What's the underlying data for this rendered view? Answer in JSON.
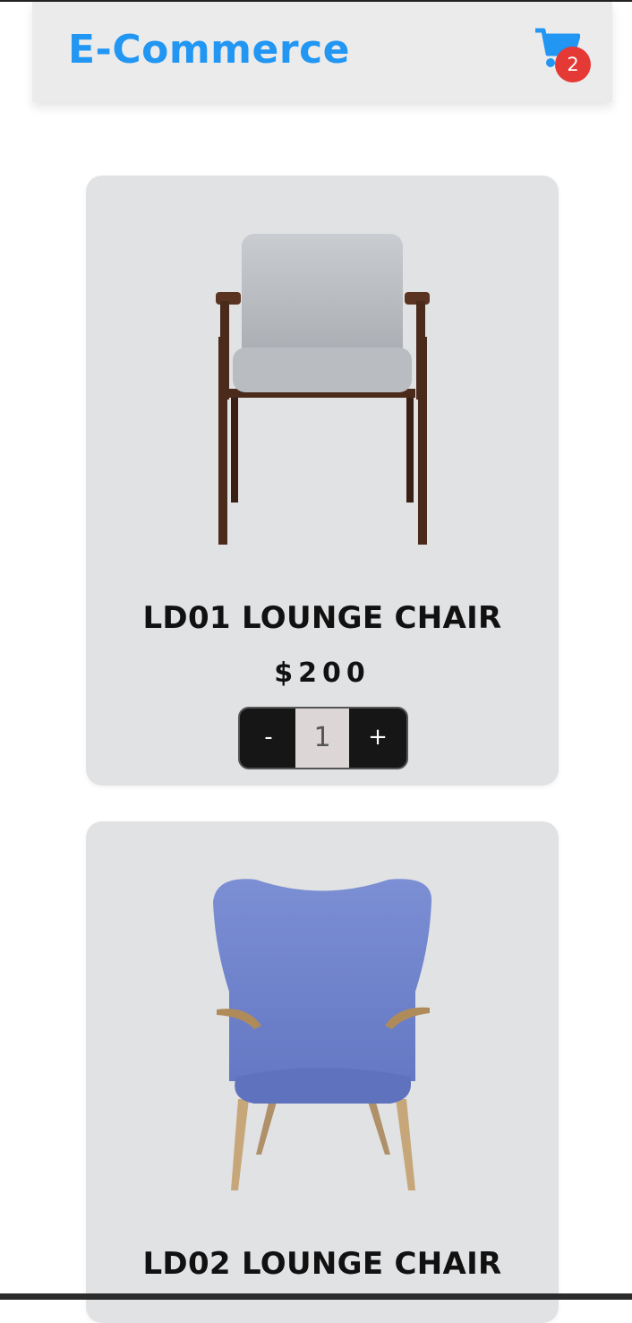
{
  "header": {
    "brand": "E-Commerce",
    "cart_count": "2",
    "cart_icon": "shopping-cart-icon"
  },
  "products": [
    {
      "name": "LD01 LOUNGE CHAIR",
      "price": "$200",
      "quantity": "1",
      "minus_label": "-",
      "plus_label": "+"
    },
    {
      "name": "LD02 LOUNGE CHAIR"
    }
  ],
  "colors": {
    "brand": "#2196f3",
    "badge": "#e53935",
    "card": "#e1e2e4",
    "stepper": "#161616"
  }
}
